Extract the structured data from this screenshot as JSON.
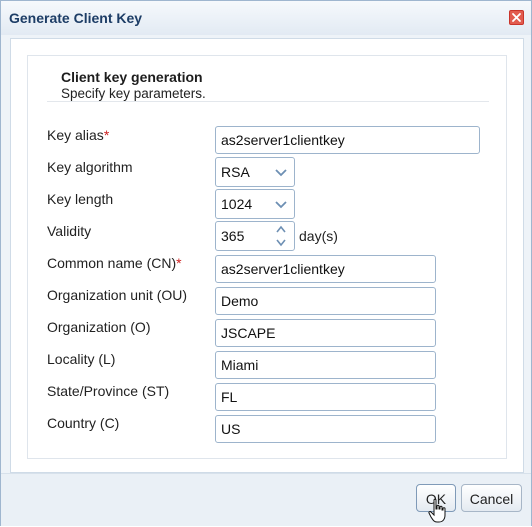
{
  "dialog": {
    "title": "Generate Client Key",
    "close_icon": "close-icon"
  },
  "section": {
    "title": "Client key generation",
    "subtitle": "Specify key parameters."
  },
  "fields": {
    "key_alias": {
      "label": "Key alias",
      "required_mark": "*",
      "value": "as2server1clientkey"
    },
    "key_algorithm": {
      "label": "Key algorithm",
      "value": "RSA"
    },
    "key_length": {
      "label": "Key length",
      "value": "1024"
    },
    "validity": {
      "label": "Validity",
      "value": "365",
      "unit": "day(s)"
    },
    "common_name": {
      "label": "Common name (CN)",
      "required_mark": "*",
      "value": "as2server1clientkey"
    },
    "org_unit": {
      "label": "Organization unit (OU)",
      "value": "Demo"
    },
    "organization": {
      "label": "Organization (O)",
      "value": "JSCAPE"
    },
    "locality": {
      "label": "Locality (L)",
      "value": "Miami"
    },
    "state": {
      "label": "State/Province (ST)",
      "value": "FL"
    },
    "country": {
      "label": "Country (C)",
      "value": "US"
    }
  },
  "buttons": {
    "ok": "OK",
    "cancel": "Cancel"
  },
  "colors": {
    "accent": "#1d3d66",
    "required": "#cc1f1f",
    "border": "#9db4cc"
  }
}
